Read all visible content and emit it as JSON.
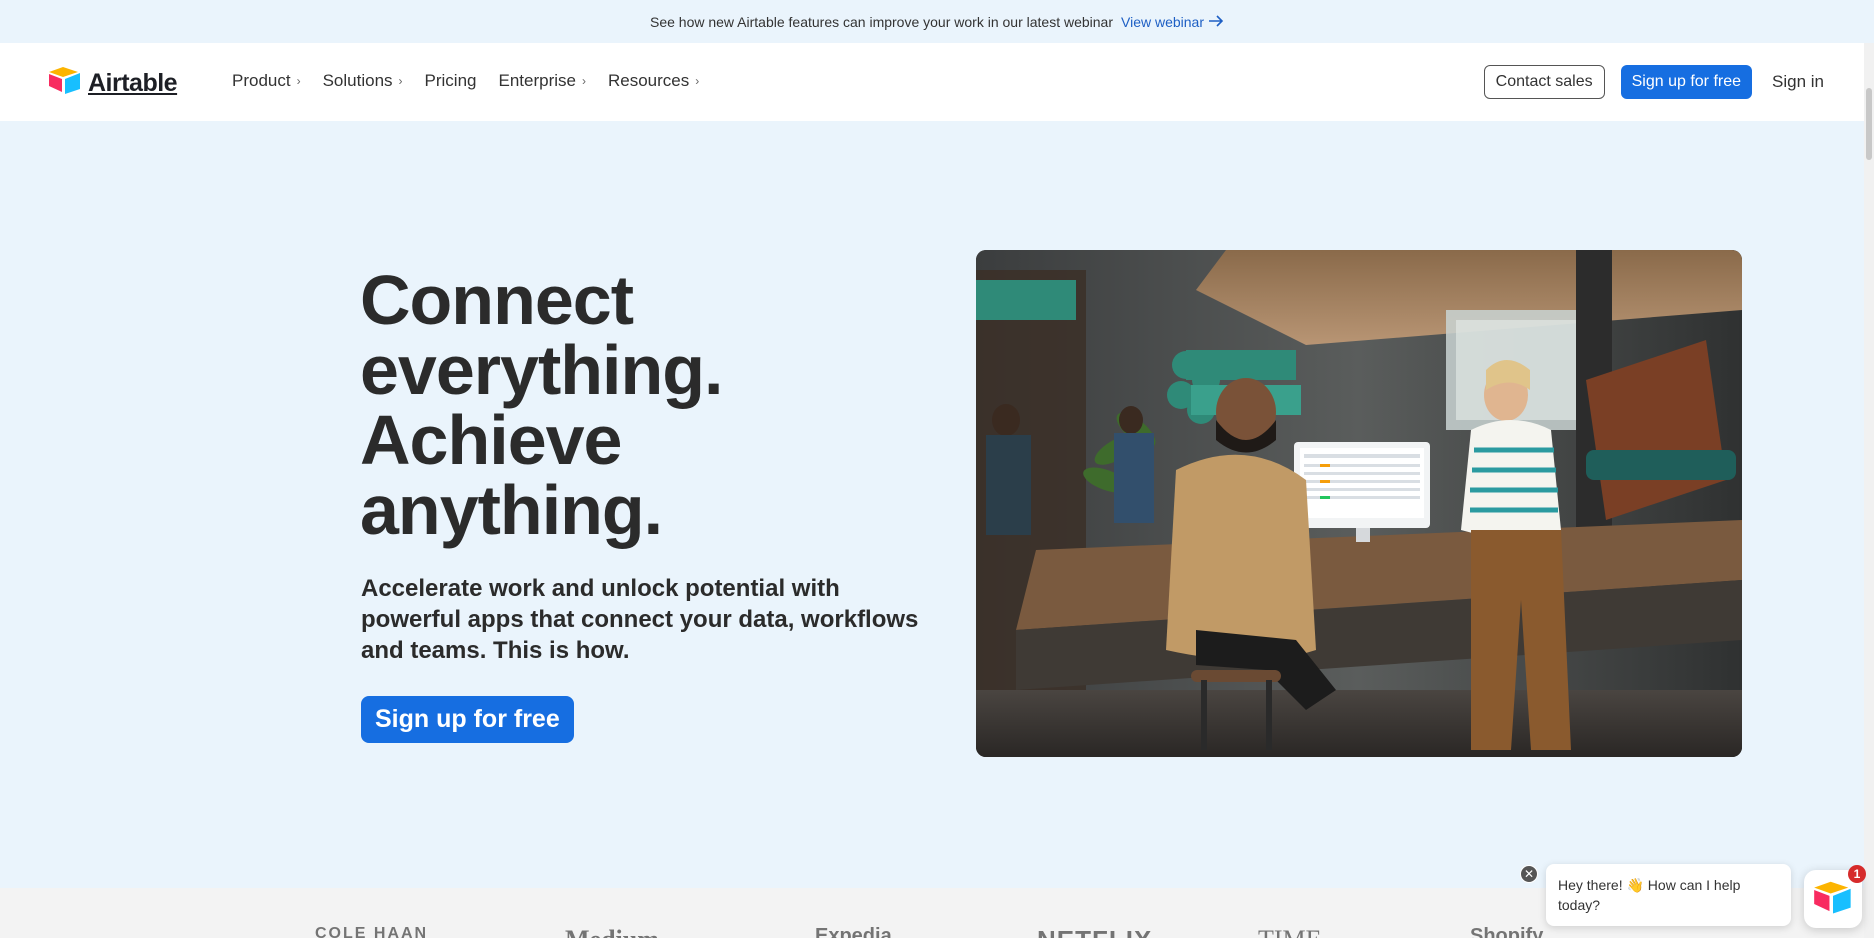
{
  "announcement": {
    "text": "See how new Airtable features can improve your work in our latest webinar",
    "link_label": "View webinar"
  },
  "nav": {
    "brand": "Airtable",
    "menu": [
      {
        "label": "Product",
        "has_chevron": true
      },
      {
        "label": "Solutions",
        "has_chevron": true
      },
      {
        "label": "Pricing",
        "has_chevron": false
      },
      {
        "label": "Enterprise",
        "has_chevron": true
      },
      {
        "label": "Resources",
        "has_chevron": true
      }
    ],
    "contact_sales": "Contact sales",
    "signup": "Sign up for free",
    "signin": "Sign in"
  },
  "hero": {
    "headline_lines": [
      "Connect",
      "everything.",
      "Achieve",
      "anything."
    ],
    "subhead": "Accelerate work and unlock potential with powerful apps that connect your data, workflows and teams. This is how.",
    "cta": "Sign up for free"
  },
  "logos": {
    "brands": [
      "COLE HAAN",
      "Medium",
      "Expedia",
      "NETFLIX",
      "TIME",
      "Shopify"
    ]
  },
  "chat": {
    "message": "Hey there! 👋 How can I help today?",
    "badge_count": "1"
  },
  "colors": {
    "primary": "#166ee1",
    "hero_bg": "#eaf4fc"
  }
}
